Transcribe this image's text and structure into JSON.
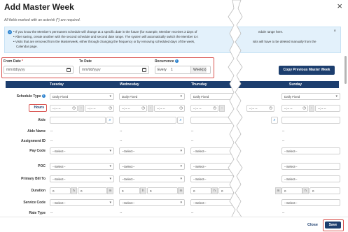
{
  "modal": {
    "title": "Add Master Week",
    "close_icon": "×"
  },
  "note": "All fields marked with an asterisk (*) are required.",
  "info": {
    "lines": [
      "If you know the Member's permanent schedule will change at a specific date in the future (for example, Member receives 3 days of",
      "After saving, create another with the second schedule and second date range. The system will automatically switch the Member to t",
      "Visits that are removed from the Masterweek, either through changing the frequency or by removing scheduled days of the week,",
      "Calendar page."
    ],
    "right_fragments": [
      "edule range here.",
      "isits will have to be deleted manually from the"
    ],
    "close": "×"
  },
  "dates": {
    "from_label": "From Date",
    "required_mark": "*",
    "from_placeholder": "mm/dd/yyyy",
    "to_label": "To Date",
    "to_placeholder": "mm/dd/yyyy",
    "recurrence_label": "Recurrence",
    "every": "Every",
    "every_value": "1",
    "unit": "Week(s)"
  },
  "copy_button": "Copy Previous Master Week",
  "days": [
    "Tuesday",
    "Wednesday",
    "Thursday",
    "Sunday"
  ],
  "rows": {
    "schedule_type": "Schedule Type",
    "hours": "Hours",
    "aide": "Aide",
    "aide_name": "Aide Name",
    "assignment_id": "Assignment ID",
    "pay_code": "Pay Code",
    "poc": "POC",
    "primary_bill_to": "Primary Bill To",
    "duration": "Duration",
    "service_code": "Service Code",
    "rate_type": "Rate Type"
  },
  "values": {
    "daily_fixed": "Daily Fixed",
    "time_placeholder": "--:-- --",
    "dash": "-",
    "none": "--",
    "select": "--Select--",
    "zero": "0",
    "h": "h",
    "m": "m"
  },
  "footer": {
    "close": "Close",
    "save": "Save"
  }
}
